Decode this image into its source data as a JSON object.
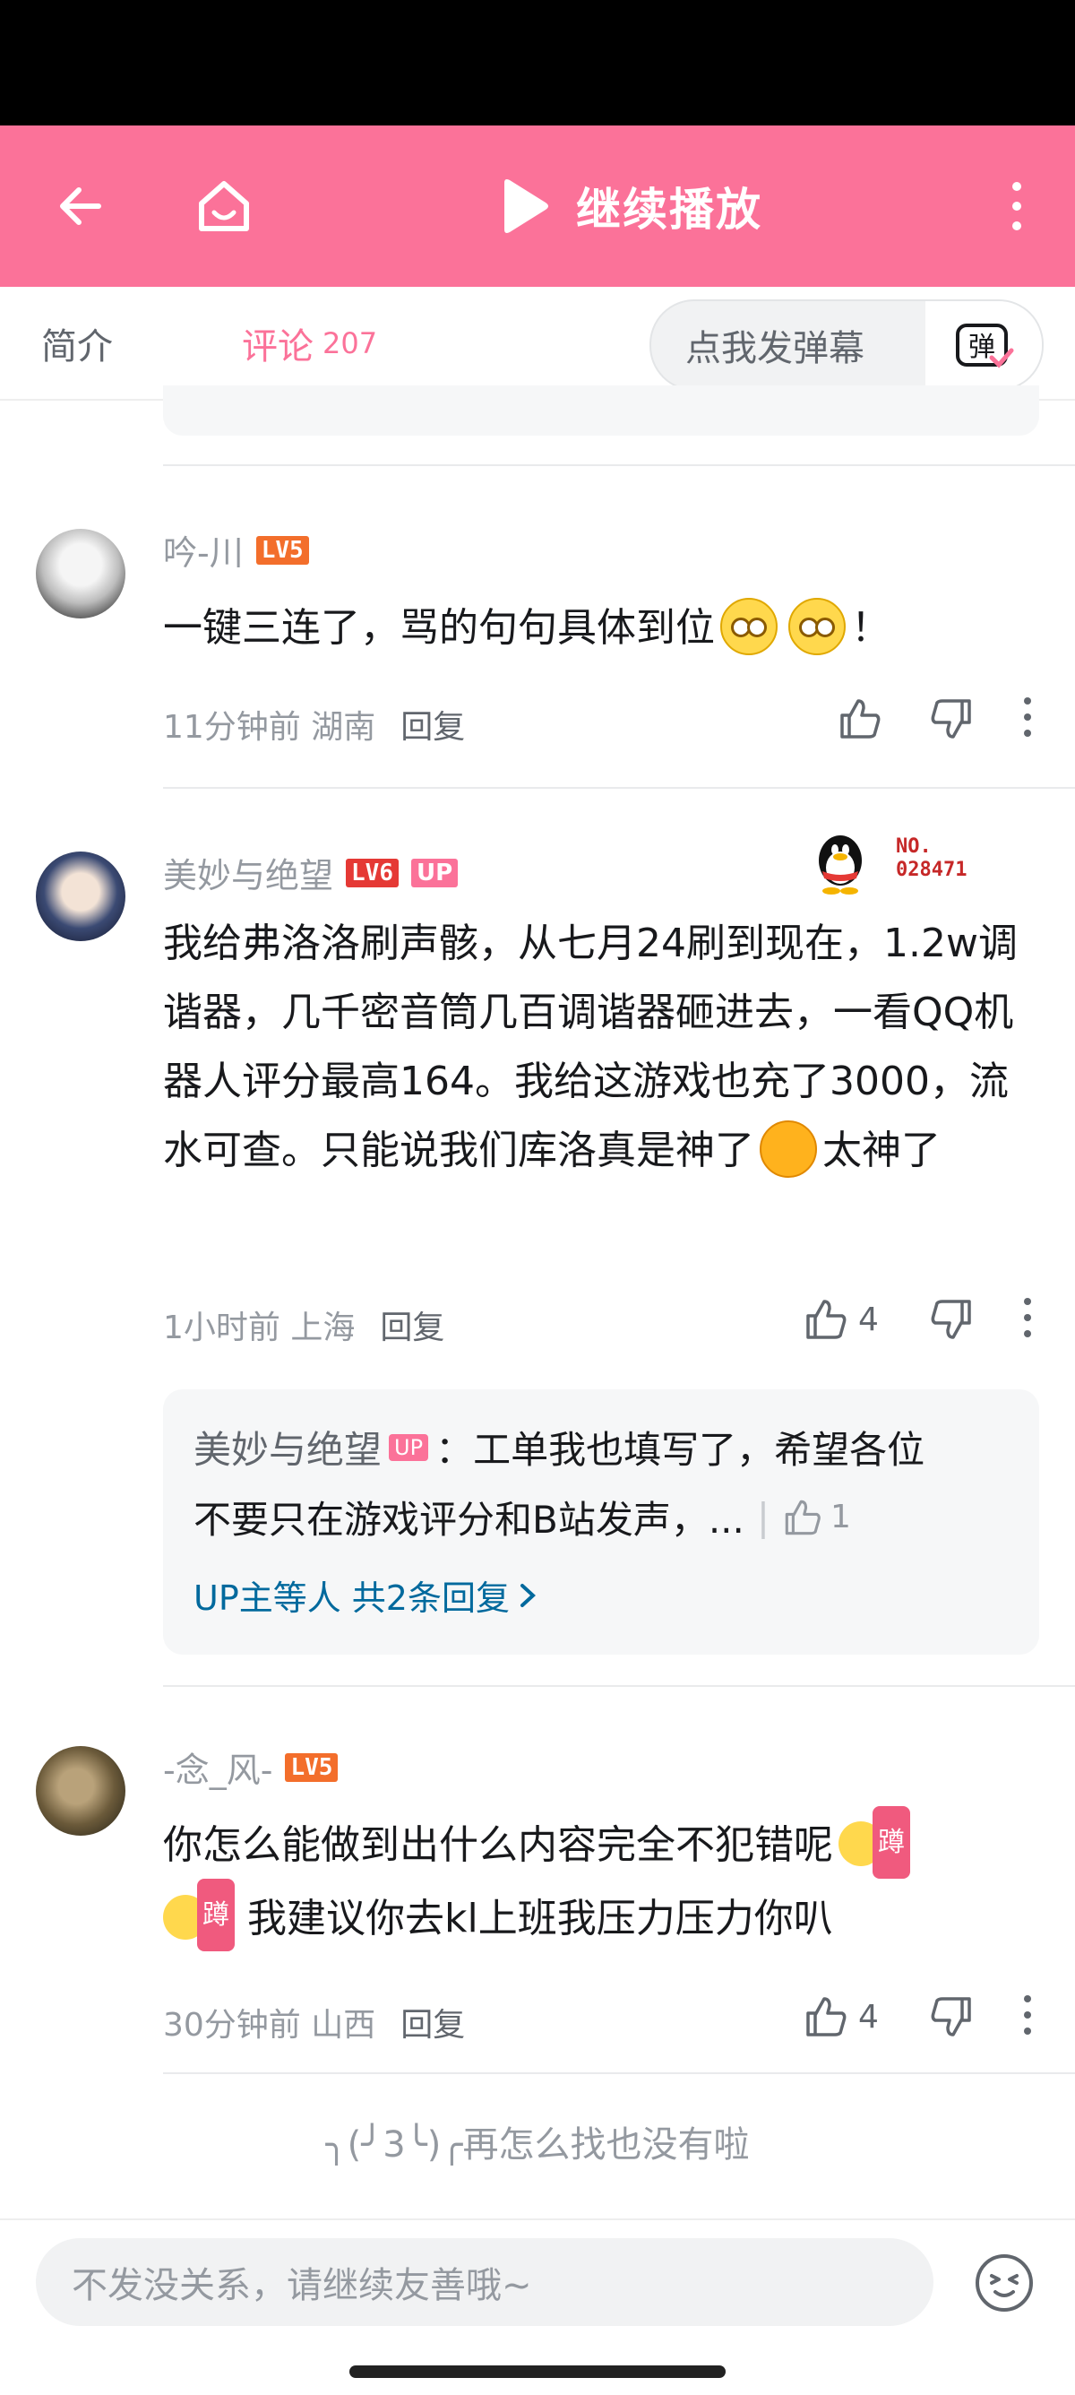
{
  "topbar": {
    "continue_label": "继续播放"
  },
  "tabs": {
    "intro": "简介",
    "comments": "评论",
    "comment_count": "207"
  },
  "danmaku": {
    "placeholder": "点我发弹幕",
    "button_glyph": "弹"
  },
  "comments": [
    {
      "user": "吟-川",
      "level": "LV5",
      "text": "一键三连了，骂的句句具体到位",
      "text_end": "！",
      "time": "11分钟前",
      "location": "湖南",
      "reply": "回复"
    },
    {
      "user": "美妙与绝望",
      "level": "LV6",
      "up_badge": "UP",
      "fan_badge_no": "NO.",
      "fan_badge_id": "028471",
      "text": "我给弗洛洛刷声骸，从七月24刷到现在，1.2w调谐器，几千密音筒几百调谐器砸进去，一看QQ机器人评分最高164。我给这游戏也充了3000，流水可查。只能说我们库洛真是神了",
      "text_end": "太神了",
      "time": "1小时前",
      "location": "上海",
      "reply": "回复",
      "likes": "4",
      "sub_reply": {
        "user": "美妙与绝望",
        "up_badge": "UP",
        "line1": "：工单我也填写了，希望各位",
        "line2": "不要只在游戏评分和B站发声，...",
        "likes": "1",
        "more": "UP主等人 共2条回复"
      }
    },
    {
      "user": "-念_风-",
      "level": "LV5",
      "text": "你怎么能做到出什么内容完全不犯错呢",
      "text2": "我建议你去kl上班我压力压力你叭",
      "sticker_label": "蹲",
      "time": "30分钟前",
      "location": "山西",
      "reply": "回复",
      "likes": "4"
    }
  ],
  "footer": {
    "no_more": "╮(╯3╰)╭再怎么找也没有啦"
  },
  "bottom": {
    "input_placeholder": "不发没关系，请继续友善哦~"
  },
  "colors": {
    "brand_pink": "#fb7299",
    "level_orange": "#f36e2b",
    "link_blue": "#00699d"
  }
}
